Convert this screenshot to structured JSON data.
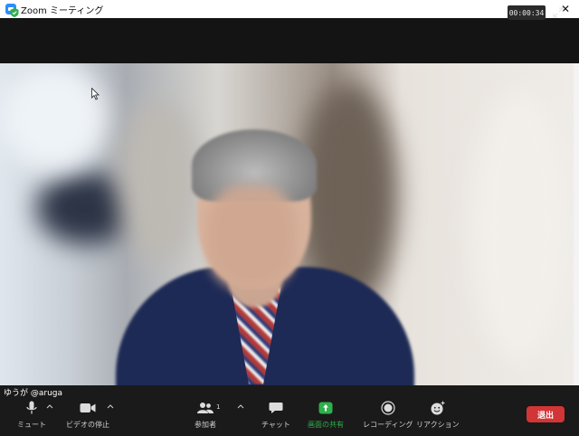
{
  "window": {
    "title": "Zoom ミーティング",
    "controls": [
      "minimize-icon",
      "maximize-icon",
      "close-icon"
    ],
    "close_glyph": "✕"
  },
  "meeting": {
    "timer": "00:00:34",
    "participant_name": "ゆうが @aruga",
    "participant_count": "1"
  },
  "toolbar": {
    "mute_label": "ミュート",
    "video_label": "ビデオの停止",
    "participants_label": "参加者",
    "chat_label": "チャット",
    "share_label": "画面の共有",
    "record_label": "レコーディング",
    "reactions_label": "リアクション",
    "end_label": "退出"
  },
  "colors": {
    "end_button": "#D23535",
    "share_icon": "#2FB04A",
    "shield_icon": "#2FB04A",
    "app_icon": "#2D8CFF",
    "toolbar_bg": "#1A1A1A"
  }
}
